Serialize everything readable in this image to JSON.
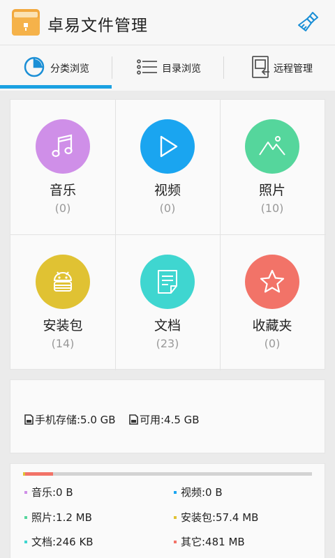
{
  "app": {
    "title": "卓易文件管理"
  },
  "tabs": [
    {
      "label": "分类浏览",
      "icon": "pie-chart-icon",
      "active": true
    },
    {
      "label": "目录浏览",
      "icon": "list-icon",
      "active": false
    },
    {
      "label": "远程管理",
      "icon": "remote-device-icon",
      "active": false
    }
  ],
  "categories": [
    {
      "label": "音乐",
      "count": "(0)",
      "color": "#cf8fe8",
      "icon": "music-note-icon"
    },
    {
      "label": "视频",
      "count": "(0)",
      "color": "#1aa5f0",
      "icon": "play-icon"
    },
    {
      "label": "照片",
      "count": "(10)",
      "color": "#55d69c",
      "icon": "mountain-photo-icon"
    },
    {
      "label": "安装包",
      "count": "(14)",
      "color": "#e0c233",
      "icon": "android-icon"
    },
    {
      "label": "文档",
      "count": "(23)",
      "color": "#3fd6d0",
      "icon": "document-icon"
    },
    {
      "label": "收藏夹",
      "count": "(0)",
      "color": "#f27368",
      "icon": "star-icon"
    }
  ],
  "storage": {
    "phone": "手机存储:5.0 GB",
    "available": "可用:4.5 GB"
  },
  "usage": {
    "items": [
      {
        "label": "音乐:0 B",
        "color": "#cf8fe8"
      },
      {
        "label": "视频:0 B",
        "color": "#1aa5f0"
      },
      {
        "label": "照片:1.2 MB",
        "color": "#55d69c"
      },
      {
        "label": "安装包:57.4 MB",
        "color": "#e0c233"
      },
      {
        "label": "文档:246 KB",
        "color": "#3fd6d0"
      },
      {
        "label": "其它:481 MB",
        "color": "#f27368"
      }
    ]
  },
  "colors": {
    "accent": "#1ba1e2"
  }
}
